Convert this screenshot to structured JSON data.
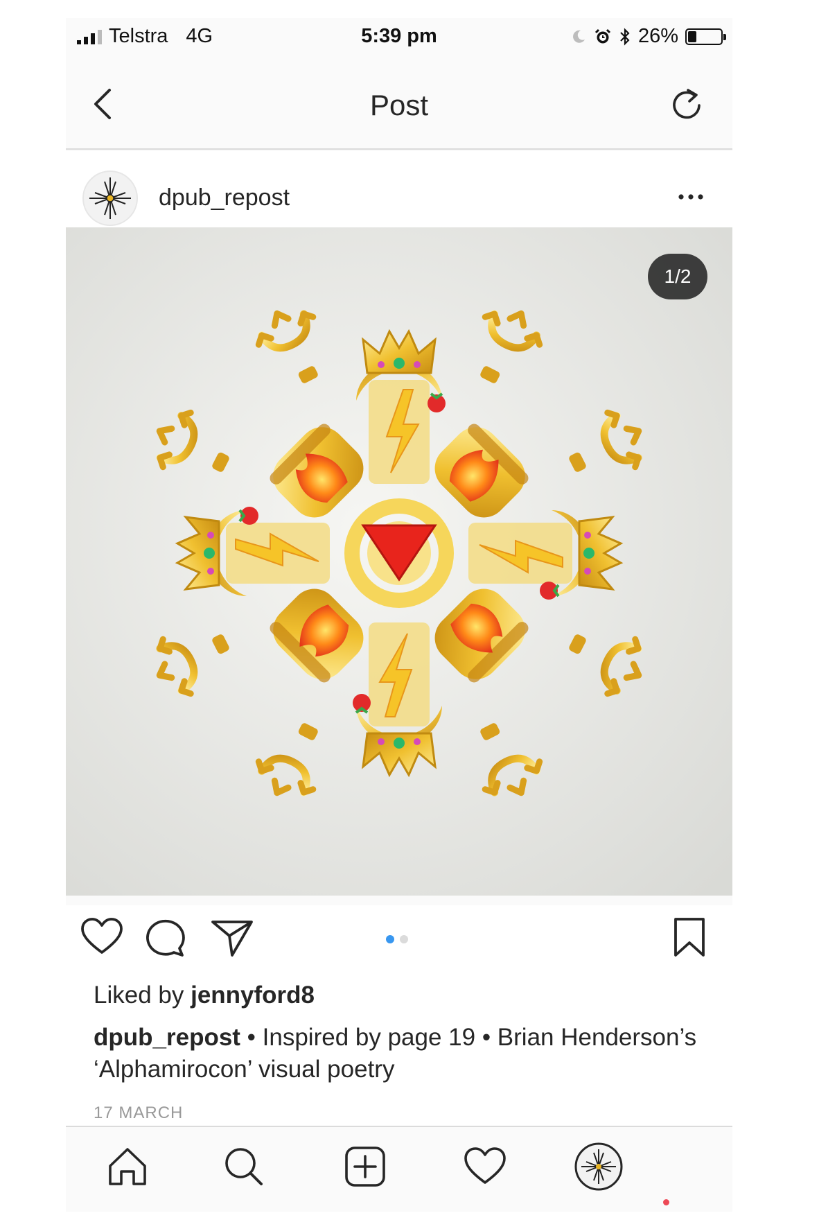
{
  "status_bar": {
    "carrier": "Telstra",
    "network": "4G",
    "time": "5:39 pm",
    "battery": "26%",
    "battery_level": 0.26
  },
  "header": {
    "title": "Post",
    "icons": [
      "chevron-left-icon",
      "refresh-icon"
    ]
  },
  "post": {
    "username": "dpub_repost",
    "image_counter": "1/2",
    "carousel": {
      "total": 2,
      "active": 1
    },
    "liked_by_prefix": "Liked by ",
    "liked_by_user": "jennyford8",
    "caption_user": "dpub_repost",
    "caption_text": " • Inspired by page 19 • Brian Henderson’s ‘Alphamirocon’ visual poetry",
    "date": "17 MARCH",
    "action_icons": [
      "heart-icon",
      "comment-icon",
      "share-icon",
      "bookmark-icon"
    ]
  },
  "tab_bar": {
    "icons": [
      "home-icon",
      "search-icon",
      "add-post-icon",
      "activity-heart-icon",
      "profile-avatar"
    ]
  },
  "colors": {
    "accent_blue": "#3897f0",
    "notification_red": "#ed4956",
    "gold": "#e8b422",
    "red_triangle": "#e8241c"
  }
}
